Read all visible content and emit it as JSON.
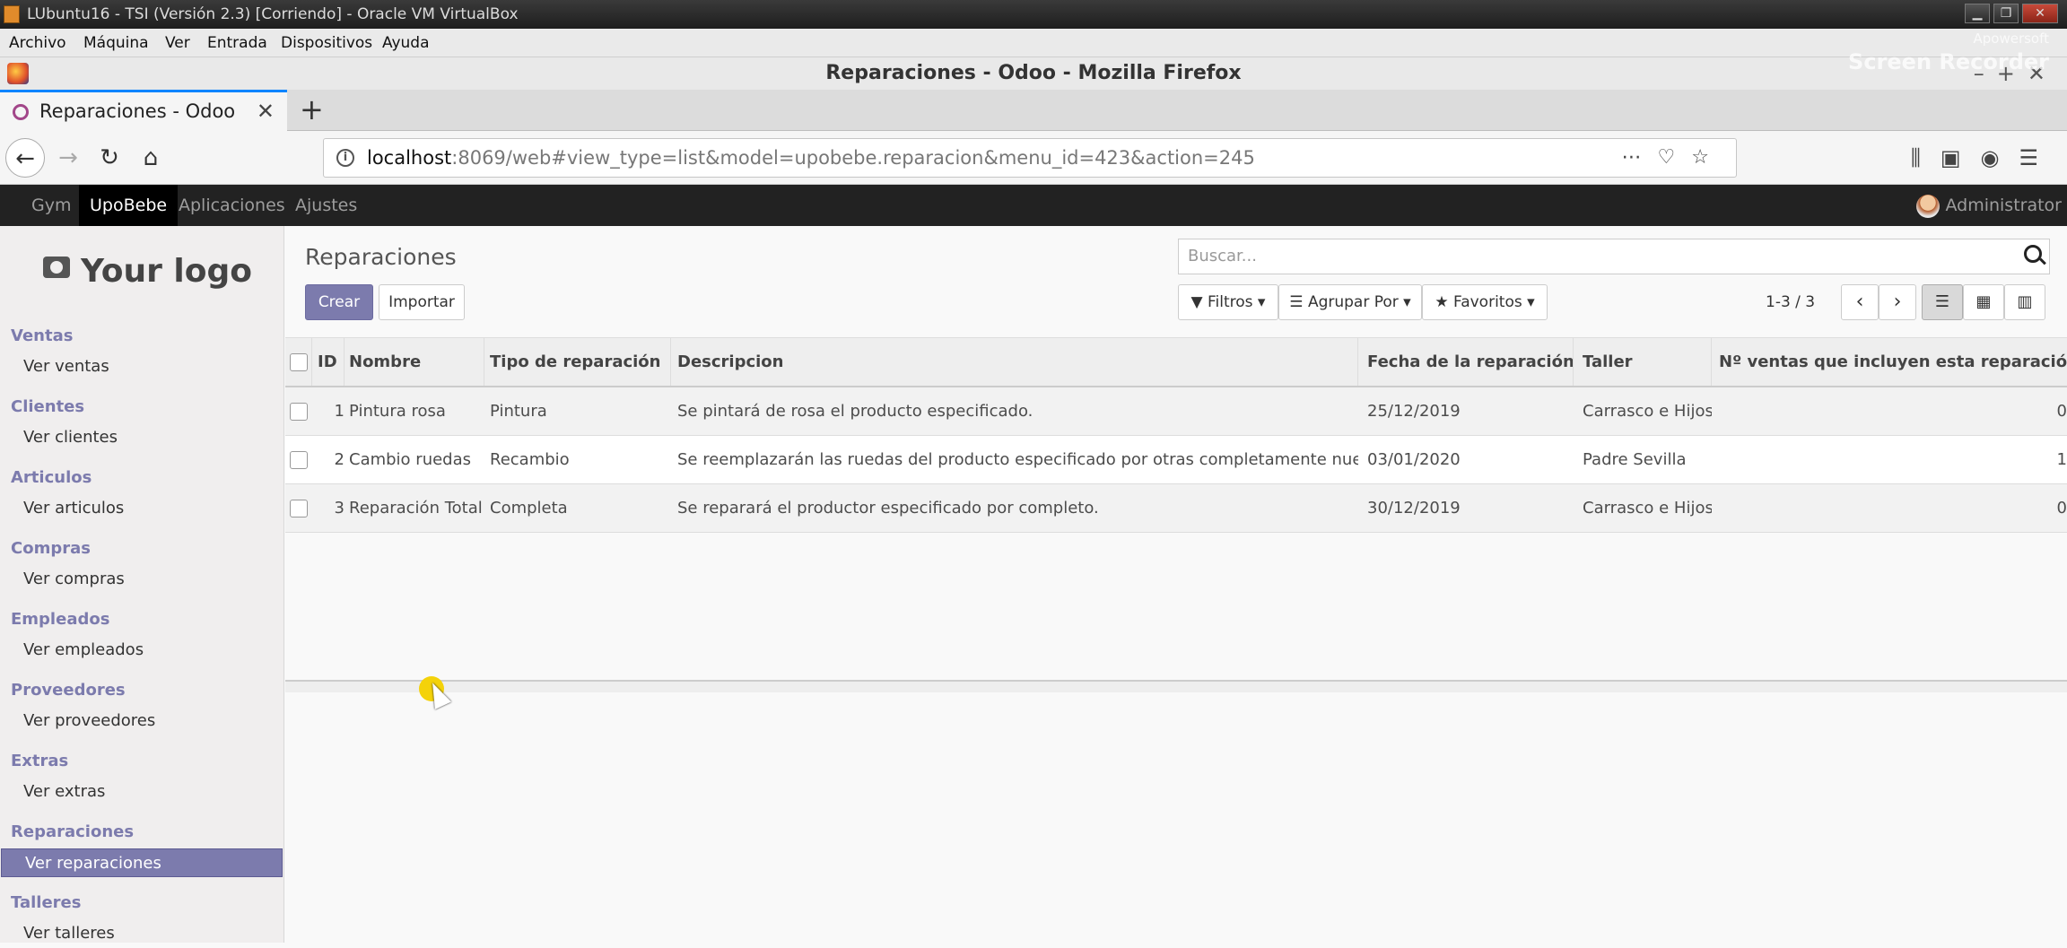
{
  "vbox": {
    "title": "LUbuntu16 - TSI (Versión 2.3) [Corriendo] - Oracle VM VirtualBox",
    "menu": [
      "Archivo",
      "Máquina",
      "Ver",
      "Entrada",
      "Dispositivos",
      "Ayuda"
    ]
  },
  "recorder": {
    "line1": "Apowersoft",
    "line2": "Screen Recorder"
  },
  "firefox": {
    "window_title": "Reparaciones - Odoo - Mozilla Firefox",
    "tab_label": "Reparaciones - Odoo",
    "url_host": "localhost",
    "url_path": ":8069/web#view_type=list&model=upobebe.reparacion&menu_id=423&action=245"
  },
  "odoo_top": {
    "apps": [
      "Gym",
      "UpoBebe",
      "Aplicaciones",
      "Ajustes"
    ],
    "active_app": "UpoBebe",
    "user": "Administrator"
  },
  "sidebar": {
    "logo": "Your logo",
    "sections": [
      {
        "title": "Ventas",
        "item": "Ver ventas"
      },
      {
        "title": "Clientes",
        "item": "Ver clientes"
      },
      {
        "title": "Articulos",
        "item": "Ver articulos"
      },
      {
        "title": "Compras",
        "item": "Ver compras"
      },
      {
        "title": "Empleados",
        "item": "Ver empleados"
      },
      {
        "title": "Proveedores",
        "item": "Ver proveedores"
      },
      {
        "title": "Extras",
        "item": "Ver extras"
      },
      {
        "title": "Reparaciones",
        "item": "Ver reparaciones"
      },
      {
        "title": "Talleres",
        "item": "Ver talleres"
      }
    ],
    "active_item": "Ver reparaciones"
  },
  "control_panel": {
    "title": "Reparaciones",
    "create_label": "Crear",
    "import_label": "Importar",
    "search_placeholder": "Buscar...",
    "filters_label": "Filtros",
    "group_by_label": "Agrupar Por",
    "favorites_label": "Favoritos",
    "pager": "1-3 / 3"
  },
  "table": {
    "headers": [
      "ID",
      "Nombre",
      "Tipo de reparación",
      "Descripcion",
      "Fecha de la reparación",
      "Taller",
      "Nº ventas que incluyen esta reparación"
    ],
    "rows": [
      [
        "1",
        "Pintura rosa",
        "Pintura",
        "Se pintará de rosa el producto especificado.",
        "25/12/2019",
        "Carrasco e Hijos",
        "0"
      ],
      [
        "2",
        "Cambio ruedas",
        "Recambio",
        "Se reemplazarán las ruedas del producto especificado por otras completamente nuevas.",
        "03/01/2020",
        "Padre Sevilla",
        "1"
      ],
      [
        "3",
        "Reparación Total",
        "Completa",
        "Se reparará el productor especificado por completo.",
        "30/12/2019",
        "Carrasco e Hijos",
        "0"
      ]
    ]
  },
  "colors": {
    "accent": "#7c7bad",
    "topbar": "#222222"
  }
}
